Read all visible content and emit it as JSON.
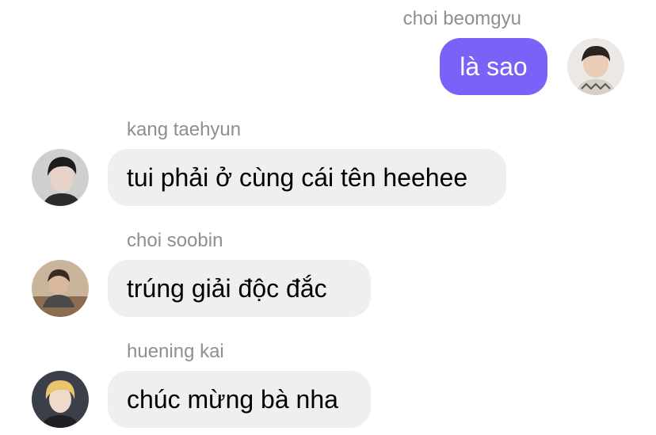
{
  "messages": [
    {
      "sender": "choi beomgyu",
      "text": "là sao",
      "outgoing": true,
      "avatar": "person-avatar-icon"
    },
    {
      "sender": "kang taehyun",
      "text": "tui phải ở cùng cái tên heehee",
      "outgoing": false,
      "avatar": "person-avatar-icon"
    },
    {
      "sender": "choi soobin",
      "text": "trúng giải độc đắc",
      "outgoing": false,
      "avatar": "person-avatar-icon"
    },
    {
      "sender": "huening kai",
      "text": "chúc mừng bà nha",
      "outgoing": false,
      "avatar": "person-avatar-icon"
    }
  ],
  "colors": {
    "outgoing_bubble": "#7b61f8",
    "incoming_bubble": "#efefef",
    "sender_name": "#8e8e93"
  }
}
